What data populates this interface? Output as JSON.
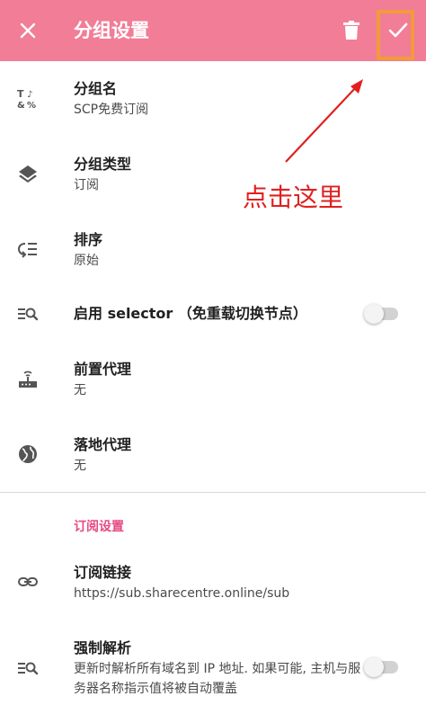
{
  "appbar": {
    "title": "分组设置",
    "color": "#f17d97",
    "close_icon": "close-icon",
    "delete_icon": "trash-icon",
    "confirm_icon": "check-icon"
  },
  "rows": {
    "group_name": {
      "title": "分组名",
      "value": "SCP免费订阅",
      "icon": "text-format-icon"
    },
    "group_type": {
      "title": "分组类型",
      "value": "订阅",
      "icon": "layers-icon"
    },
    "sort": {
      "title": "排序",
      "value": "原始",
      "icon": "sort-icon"
    },
    "selector": {
      "title": "启用 selector （免重载切换节点）",
      "toggle": false,
      "icon": "search-list-icon"
    },
    "front_proxy": {
      "title": "前置代理",
      "value": "无",
      "icon": "router-icon"
    },
    "landing_proxy": {
      "title": "落地代理",
      "value": "无",
      "icon": "globe-icon"
    }
  },
  "subscription_section": {
    "header": "订阅设置",
    "header_color": "#e64a84",
    "link": {
      "title": "订阅链接",
      "value": "https://sub.sharecentre.online/sub",
      "icon": "link-icon"
    },
    "force_resolve": {
      "title": "强制解析",
      "value": "更新时解析所有域名到 IP 地址. 如果可能, 主机与服务器名称指示值将被自动覆盖",
      "toggle": false,
      "icon": "search-list-icon"
    }
  },
  "annotation": {
    "text": "点击这里",
    "color": "#e02020",
    "highlight_color": "#f39a3c"
  }
}
